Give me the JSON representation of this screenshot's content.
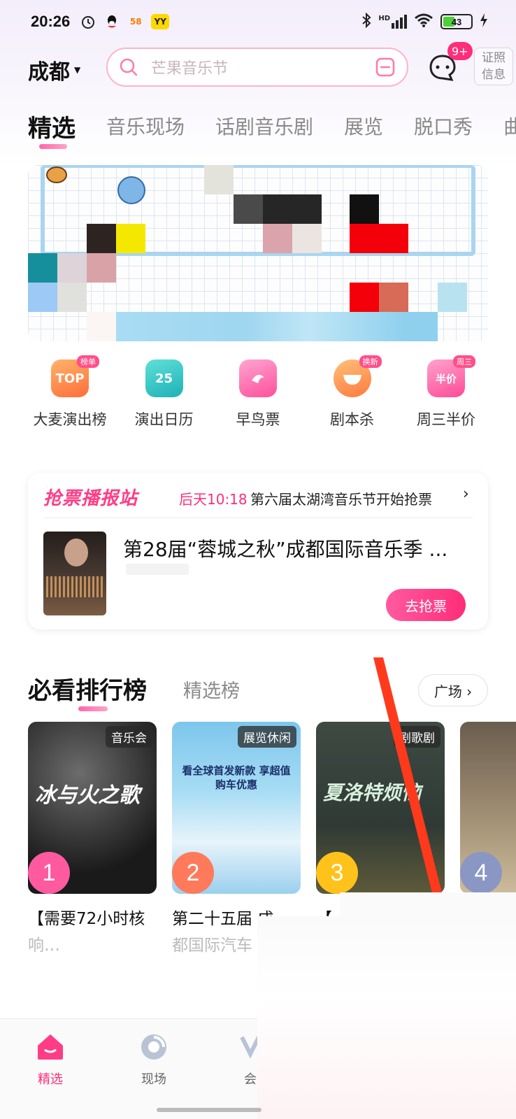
{
  "status_bar": {
    "time": "20:26",
    "app_icons": [
      "alarm-icon",
      "qq-icon",
      "58-icon",
      "yy-icon"
    ],
    "yy_label": "YY",
    "battery": "43",
    "signal": "HD"
  },
  "header": {
    "city": "成都",
    "search_placeholder": "芒果音乐节",
    "msg_badge": "9+",
    "id_info_line1": "证照",
    "id_info_line2": "信息"
  },
  "tabs": [
    {
      "label": "精选",
      "active": true
    },
    {
      "label": "音乐现场"
    },
    {
      "label": "话剧音乐剧"
    },
    {
      "label": "展览"
    },
    {
      "label": "脱口秀"
    },
    {
      "label": "曲"
    }
  ],
  "quick_entries": [
    {
      "label": "大麦演出榜",
      "icon_text": "TOP",
      "badge": "榜单",
      "color": "#ff8a4c"
    },
    {
      "label": "演出日历",
      "icon_text": "25",
      "badge": "",
      "color": "#2cc7c0"
    },
    {
      "label": "早鸟票",
      "icon_text": "",
      "badge": "",
      "color": "#ff6fb3"
    },
    {
      "label": "剧本杀",
      "icon_text": "",
      "badge": "换新",
      "color": "#ff8f4a"
    },
    {
      "label": "周三半价",
      "icon_text": "半价",
      "badge": "周三",
      "color": "#ff5aa6"
    }
  ],
  "ticket_card": {
    "brand": "抢票播报站",
    "time": "后天10:18",
    "notice": "第六届太湖湾音乐节开始抢票",
    "title": "第28届“蓉城之秋”成都国际音乐季 ...",
    "button": "去抢票"
  },
  "ranking": {
    "title": "必看排行榜",
    "tab2": "精选榜",
    "plaza": "广场 ›",
    "cards": [
      {
        "rank": "1",
        "category": "音乐会",
        "poster_text": "冰与火之歌",
        "title": "【需要72小时核",
        "title2": "响…",
        "rank_color": "#ff5aa0"
      },
      {
        "rank": "2",
        "category": "展览休闲",
        "poster_text": "看全球首发新款 享超值购车优惠",
        "title": "第二十五届 成",
        "title2": "都国际汽车",
        "rank_color": "#ff7a5a"
      },
      {
        "rank": "3",
        "category": "剧歌剧",
        "poster_text": "夏洛特烦恼",
        "title": "【",
        "title2": "",
        "rank_color": "#ffc21a"
      },
      {
        "rank": "4",
        "category": "",
        "poster_text": "",
        "title": "",
        "title2": "",
        "rank_color": "#8a96c4"
      }
    ]
  },
  "bottom_nav": [
    {
      "label": "精选",
      "active": true
    },
    {
      "label": "现场"
    },
    {
      "label": "会"
    }
  ]
}
